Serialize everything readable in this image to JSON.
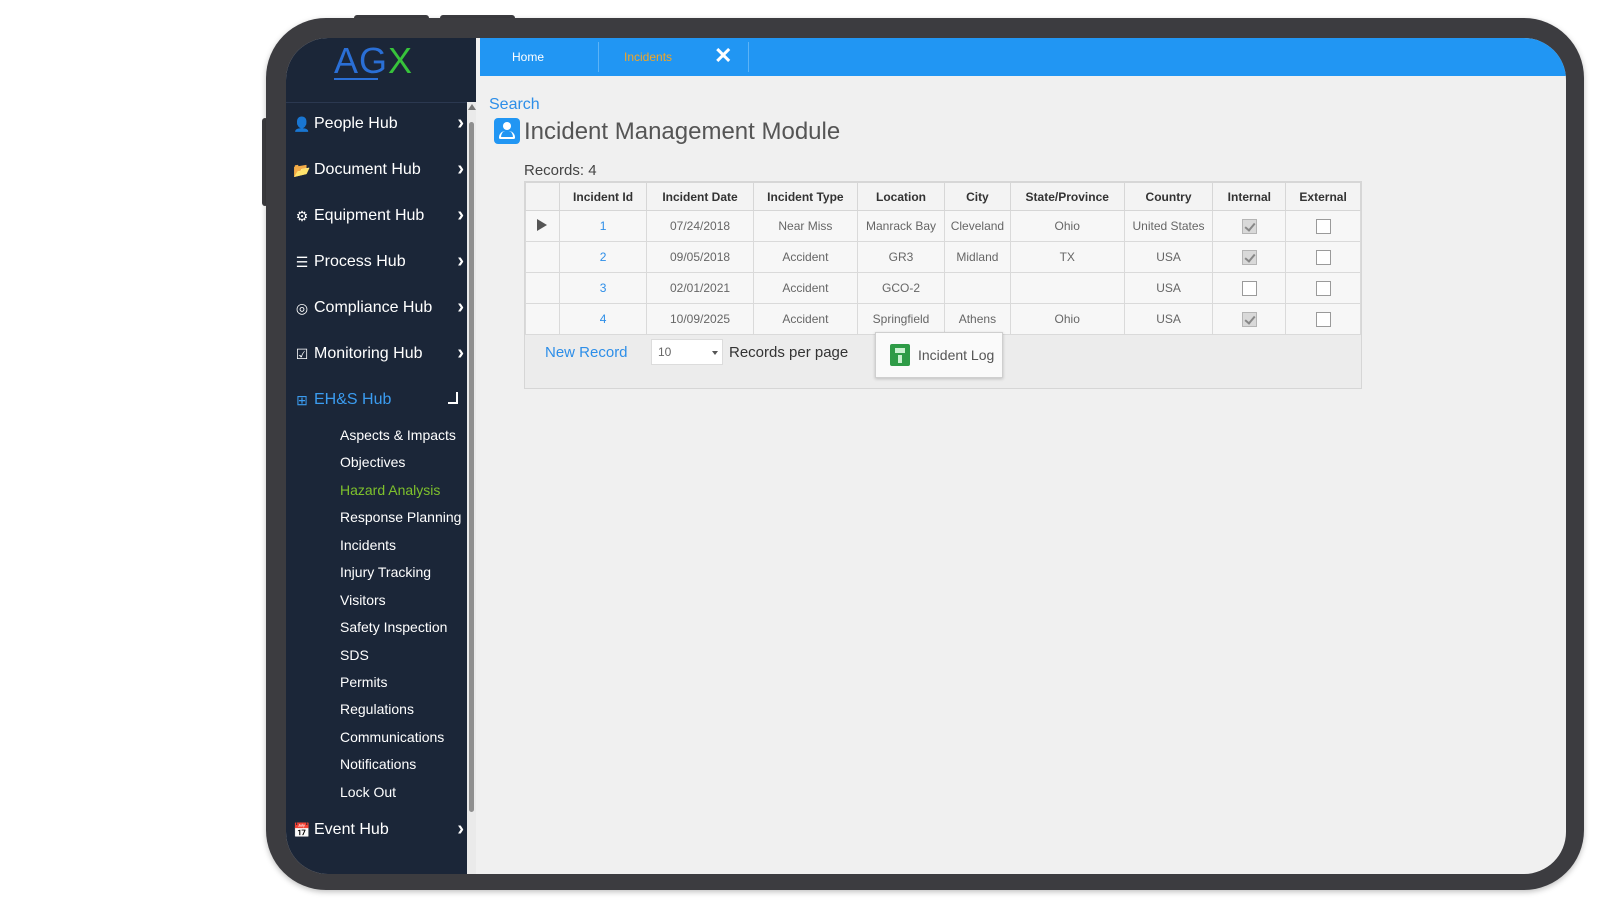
{
  "brand": {
    "logo_ag": "AG",
    "logo_x": "X",
    "colors": {
      "ag": "#2a6fd6",
      "x": "#37c33b"
    }
  },
  "tabs": [
    {
      "label": "Home"
    },
    {
      "label": "Incidents",
      "active": true
    }
  ],
  "sidebar": {
    "items": [
      {
        "label": "People Hub",
        "icon": "person-icon"
      },
      {
        "label": "Document Hub",
        "icon": "folder-icon"
      },
      {
        "label": "Equipment Hub",
        "icon": "gears-icon"
      },
      {
        "label": "Process Hub",
        "icon": "list-icon"
      },
      {
        "label": "Compliance Hub",
        "icon": "target-icon"
      },
      {
        "label": "Monitoring Hub",
        "icon": "checkbox-icon"
      },
      {
        "label": "EH&S Hub",
        "icon": "plus-square-icon",
        "expanded": true
      },
      {
        "label": "Event Hub",
        "icon": "calendar-icon"
      }
    ],
    "ehs_subitems": [
      "Aspects & Impacts",
      "Objectives",
      "Hazard Analysis",
      "Response Planning",
      "Incidents",
      "Injury Tracking",
      "Visitors",
      "Safety Inspection",
      "SDS",
      "Permits",
      "Regulations",
      "Communications",
      "Notifications",
      "Lock Out"
    ],
    "highlighted_subitem": "Hazard Analysis",
    "highlight_color": "#7ec12c"
  },
  "main": {
    "search_link": "Search",
    "title": "Incident Management Module",
    "records_label": "Records:  4",
    "table": {
      "columns": [
        "Incident Id",
        "Incident Date",
        "Incident Type",
        "Location",
        "City",
        "State/Province",
        "Country",
        "Internal",
        "External"
      ],
      "rows": [
        {
          "id": "1",
          "date": "07/24/2018",
          "type": "Near Miss",
          "location": "Manrack Bay",
          "city": "Cleveland",
          "state": "Ohio",
          "country": "United States",
          "internal": true,
          "external": false,
          "selected": true
        },
        {
          "id": "2",
          "date": "09/05/2018",
          "type": "Accident",
          "location": "GR3",
          "city": "Midland",
          "state": "TX",
          "country": "USA",
          "internal": true,
          "external": false
        },
        {
          "id": "3",
          "date": "02/01/2021",
          "type": "Accident",
          "location": "GCO-2",
          "city": "",
          "state": "",
          "country": "USA",
          "internal": false,
          "external": false
        },
        {
          "id": "4",
          "date": "10/09/2025",
          "type": "Accident",
          "location": "Springfield",
          "city": "Athens",
          "state": "Ohio",
          "country": "USA",
          "internal": true,
          "external": false
        }
      ]
    },
    "new_record_label": "New Record",
    "per_page_value": "10",
    "per_page_label": "Records per page",
    "incident_log_label": "Incident Log"
  }
}
